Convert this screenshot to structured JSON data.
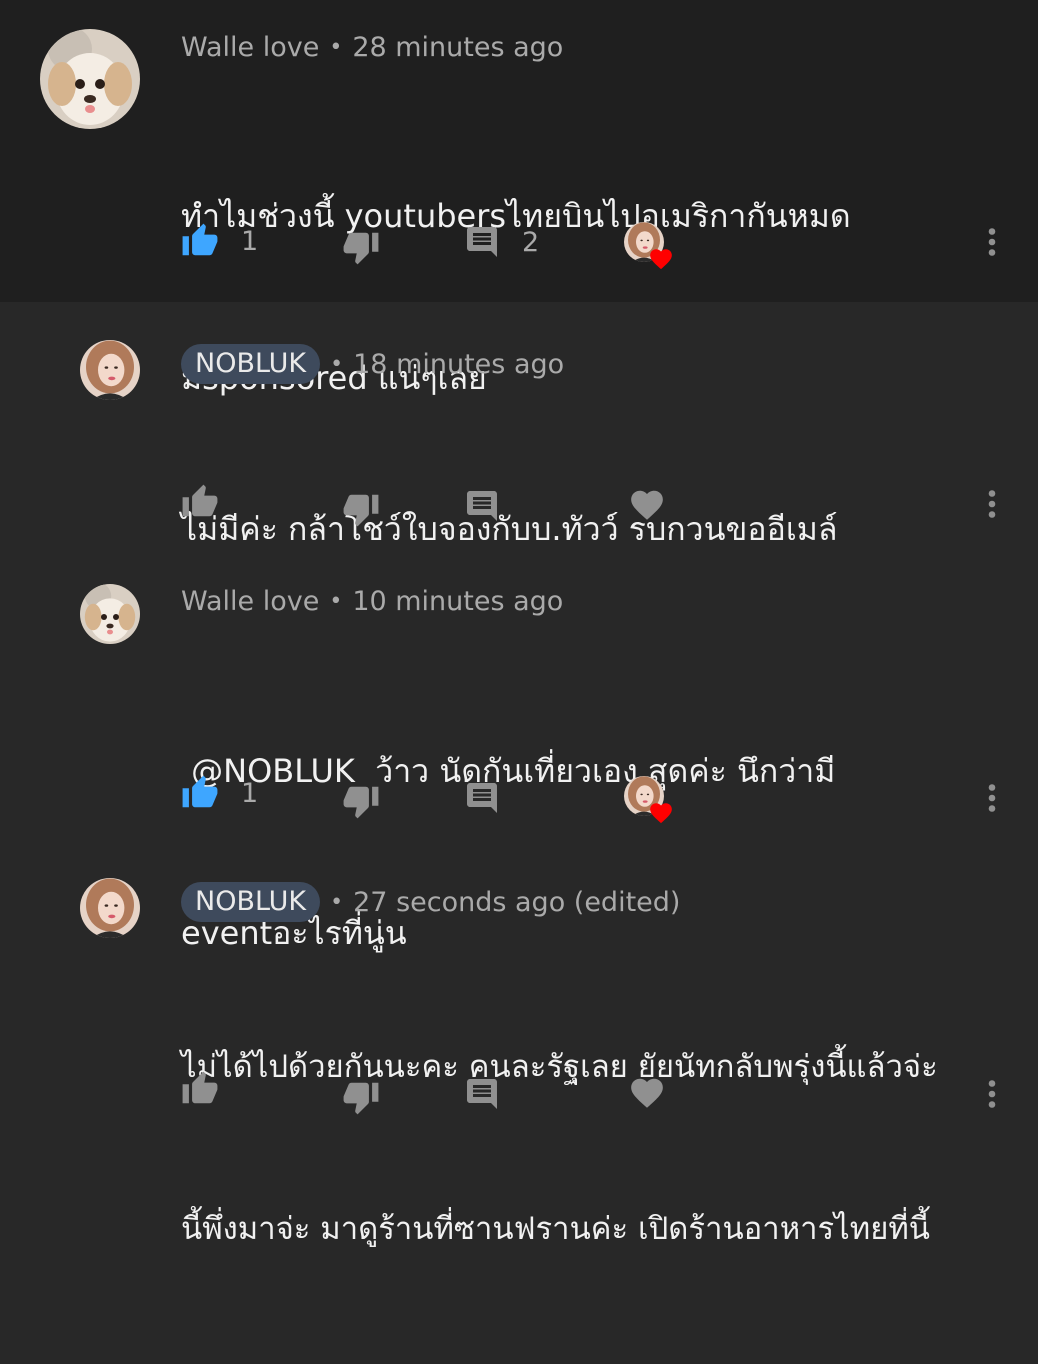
{
  "comments": [
    {
      "author": "Walle love",
      "time": "28 minutes ago",
      "text_lines": [
        "ทำไมช่วงนี้ youtubersไทยบินไปอเมริกากันหมด",
        "มีsponsored แน่ๆเลย"
      ],
      "like_count": "1",
      "reply_count": "2",
      "liked": true,
      "creator_hearted": true
    },
    {
      "author": "NOBLUK",
      "time": "18 minutes ago",
      "text_lines": [
        "ไม่มีค่ะ กล้าโชว์ใบจองกับบ.ทัวว์ รบกวนขออีเมล์"
      ],
      "liked": false,
      "creator_hearted": false
    },
    {
      "author": "Walle love",
      "time": "10 minutes ago",
      "text_lines": [
        " @NOBLUK  ว้าว นัดกันเที่ยวเอง สุดค่ะ นึกว่ามี",
        "eventอะไรที่นู่น"
      ],
      "like_count": "1",
      "liked": true,
      "creator_hearted": true
    },
    {
      "author": "NOBLUK",
      "time": "27 seconds ago (edited)",
      "text_lines": [
        "ไม่ได้ไปด้วยกันนะคะ คนละรัฐเลย ยัยนัทกลับพรุ่งนี้แล้วจ่ะ",
        "นี้พึ่งมาจ่ะ มาดูร้านที่ซานฟรานค่ะ เปิดร้านอาหารไทยที่นี้"
      ],
      "liked": false,
      "creator_hearted": false
    }
  ],
  "separator_dot": "•",
  "colors": {
    "liked_blue": "#3ea6ff",
    "icon_gray": "#909090",
    "heart_red": "#ff0000",
    "top_bg": "#1f1f1f",
    "reply_bg": "#282828",
    "creator_badge_bg": "#3e4a5c"
  },
  "icons": [
    "thumb-up-icon",
    "thumb-down-icon",
    "reply-icon",
    "heart-icon",
    "more-vert-icon",
    "creator-heart-badge-icon"
  ]
}
